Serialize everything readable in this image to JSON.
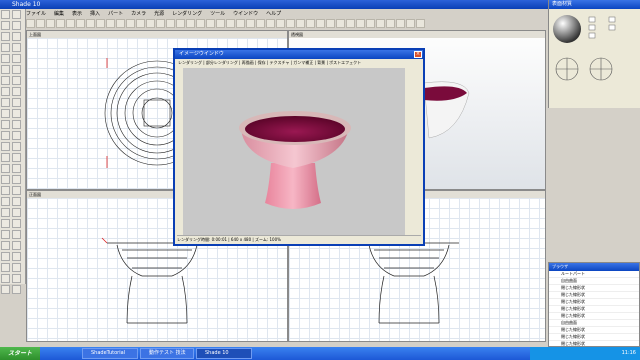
{
  "app": {
    "title": "Shade 10"
  },
  "menubar": [
    "ファイル",
    "編集",
    "表示",
    "挿入",
    "パート",
    "カメラ",
    "光源",
    "レンダリング",
    "ツール",
    "ウインドウ",
    "ヘルプ"
  ],
  "viewports": [
    {
      "label": "上面図"
    },
    {
      "label": "透視図"
    },
    {
      "label": "正面図"
    },
    {
      "label": "右面図"
    }
  ],
  "preview": {
    "title": "イメージウインドウ",
    "toolbar": "レンダリング | 部分レンダリング | 再描画 | 保存 | テクスチャ | ガンマ補正 | 背景 | ポストエフェクト",
    "status": "レンダリング時間: 0:00:01 | 640 x 480 | ズーム: 100%"
  },
  "surface": {
    "title": "表面材質"
  },
  "browser": {
    "title": "ブラウザ",
    "items": [
      "ルートパート",
      "自由曲面",
      "閉じた線形状",
      "閉じた線形状",
      "閉じた線形状",
      "閉じた線形状",
      "閉じた線形状",
      "自由曲面",
      "閉じた線形状",
      "閉じた線形状",
      "閉じた線形状",
      "カメラ"
    ]
  },
  "taskbar": {
    "start": "スタート",
    "tasks": [
      "ShadeTutorial",
      "動作テスト 技法",
      "Shade 10"
    ],
    "clock": "11:16"
  },
  "colors": {
    "cup_inside": "#7a0b3b",
    "cup_outside": "#e9a7b5",
    "xp_blue": "#0a3fb5"
  }
}
